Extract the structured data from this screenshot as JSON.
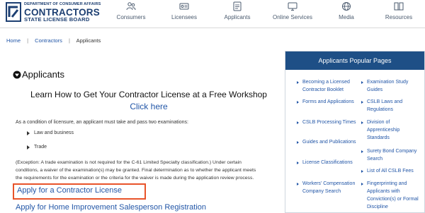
{
  "header": {
    "logo": {
      "line1": "DEPARTMENT OF CONSUMER AFFAIRS",
      "line2": "CONTRACTORS",
      "line3": "STATE LICENSE BOARD",
      "badge": "CSLB"
    },
    "nav": [
      {
        "label": "Consumers",
        "icon": "consumers-icon"
      },
      {
        "label": "Licensees",
        "icon": "licensees-icon"
      },
      {
        "label": "Applicants",
        "icon": "applicants-icon"
      },
      {
        "label": "Online Services",
        "icon": "online-services-icon"
      },
      {
        "label": "Media",
        "icon": "media-icon"
      },
      {
        "label": "Resources",
        "icon": "resources-icon"
      }
    ],
    "nav_icon_color": "#4a5a6e"
  },
  "breadcrumb": {
    "items": [
      "Home",
      "Contractors",
      "Applicants"
    ],
    "separator": "|"
  },
  "main": {
    "title": "Applicants",
    "workshop_heading": "Learn How to Get Your Contractor License at a Free Workshop",
    "click_here": "Click here",
    "intro": "As a condition of licensure, an applicant must take and pass two examinations:",
    "exams": [
      "Law and business",
      "Trade"
    ],
    "exception_line1": "(Exception: A trade examination is not required for the C-61 Limited Specialty classification.) Under certain",
    "exception_line2": "conditions, a waiver of the examination(s) may be granted. Final determination as to whether the applicant meets",
    "exception_line3": "the requirements for the examination or the criteria for the waiver is made during the application review process.",
    "apply_contractor": "Apply for a Contractor License",
    "apply_his": "Apply for Home Improvement Salesperson Registration",
    "highlight_color": "#e8532a",
    "link_color": "#2256a7"
  },
  "popular": {
    "title": "Applicants Popular Pages",
    "header_color": "#1e4f86",
    "col1": [
      "Becoming a Licensed Contractor Booklet",
      "Forms and Applications",
      "CSLB Processing Times",
      "Guides and Publications",
      "License Classifications",
      "Workers' Compensation Company Search"
    ],
    "col2": [
      "Examination Study Guides",
      "CSLB Laws and Regulations",
      "Division of Apprenticeship Standards",
      "Surety Bond Company Search",
      "List of All CSLB Fees",
      "Fingerprinting and Applicants with Conviction(s) or Formal Discipline"
    ]
  }
}
